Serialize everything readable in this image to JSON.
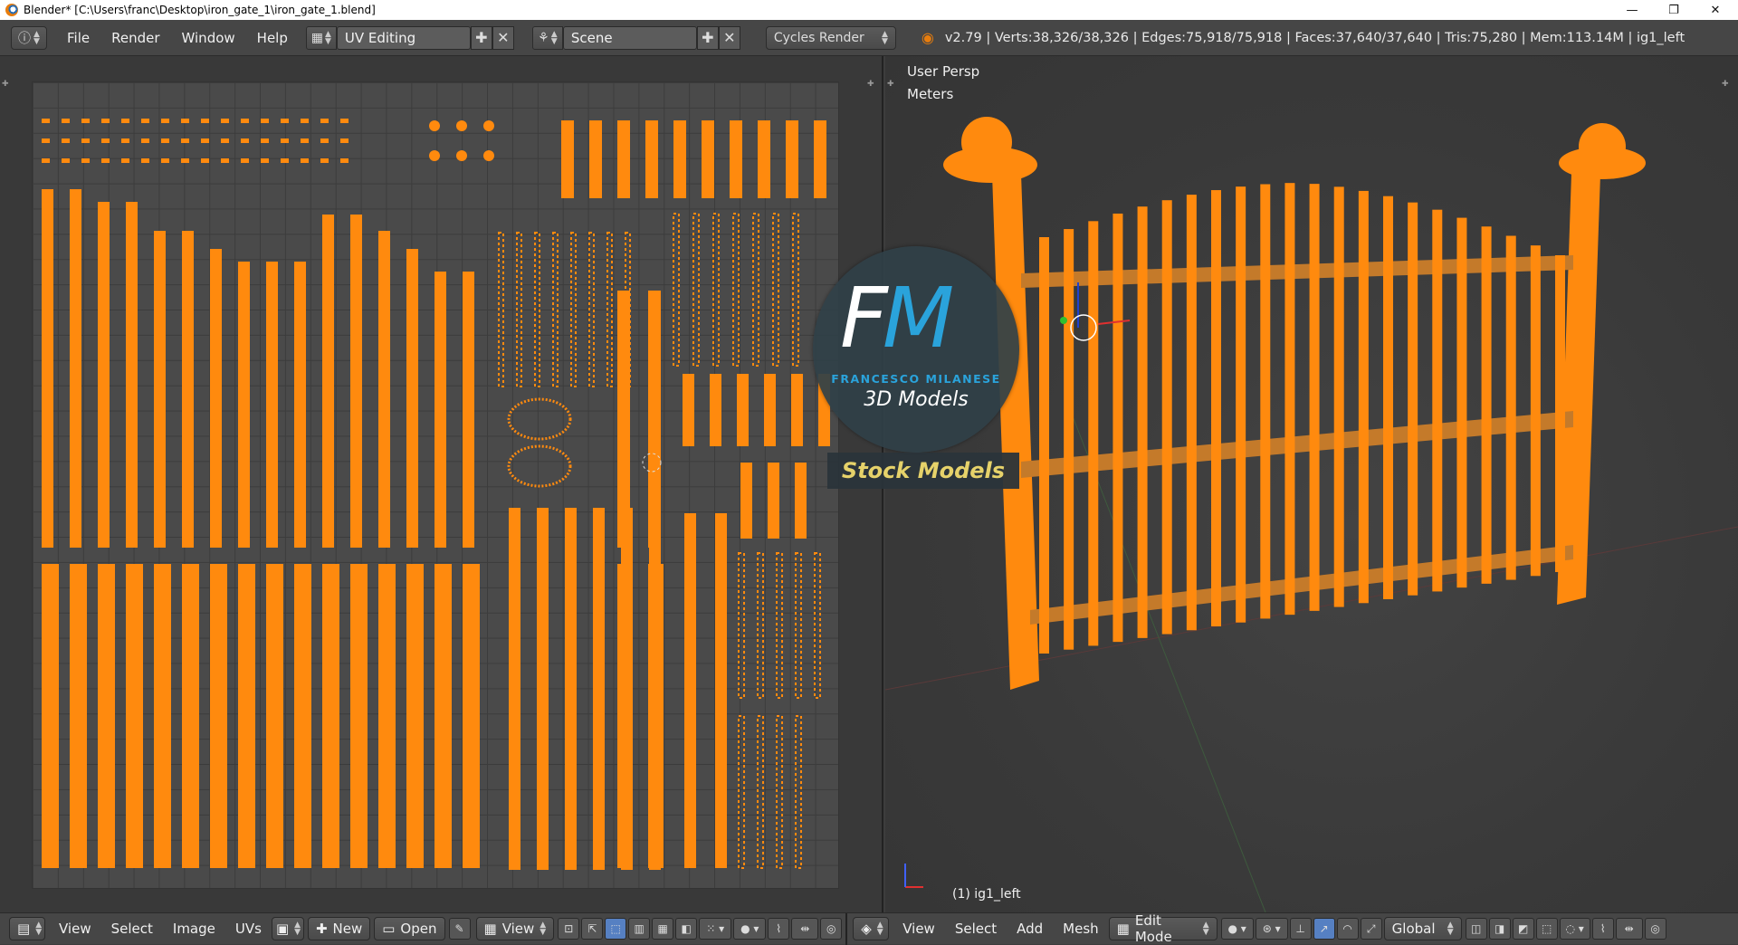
{
  "window": {
    "title": "Blender* [C:\\Users\\franc\\Desktop\\iron_gate_1\\iron_gate_1.blend]",
    "minimize": "—",
    "maximize": "❐",
    "close": "✕"
  },
  "info_bar": {
    "menus": [
      "File",
      "Render",
      "Window",
      "Help"
    ],
    "screen_layout": "UV Editing",
    "scene": "Scene",
    "render_engine": "Cycles Render",
    "stats": "v2.79 | Verts:38,326/38,326 | Edges:75,918/75,918 | Faces:37,640/37,640 | Tris:75,280 | Mem:113.14M | ig1_left"
  },
  "viewport": {
    "view_name": "User Persp",
    "units": "Meters",
    "object_label": "(1) ig1_left"
  },
  "uv_bottom": {
    "menus": [
      "View",
      "Select",
      "Image",
      "UVs"
    ],
    "new_label": "New",
    "open_label": "Open",
    "view_label": "View"
  },
  "vp_bottom": {
    "menus": [
      "View",
      "Select",
      "Add",
      "Mesh"
    ],
    "mode": "Edit Mode",
    "orientation": "Global"
  },
  "watermark": {
    "letter_f": "F",
    "letter_m": "M",
    "name": "FRANCESCO MILANESE",
    "subtitle": "3D Models",
    "tagline": "Stock Models"
  },
  "colors": {
    "mesh_orange": "#ff8a0e",
    "uv_grid": "#4a4a4a",
    "header": "#464646",
    "accent_blue": "#2aa3db"
  }
}
